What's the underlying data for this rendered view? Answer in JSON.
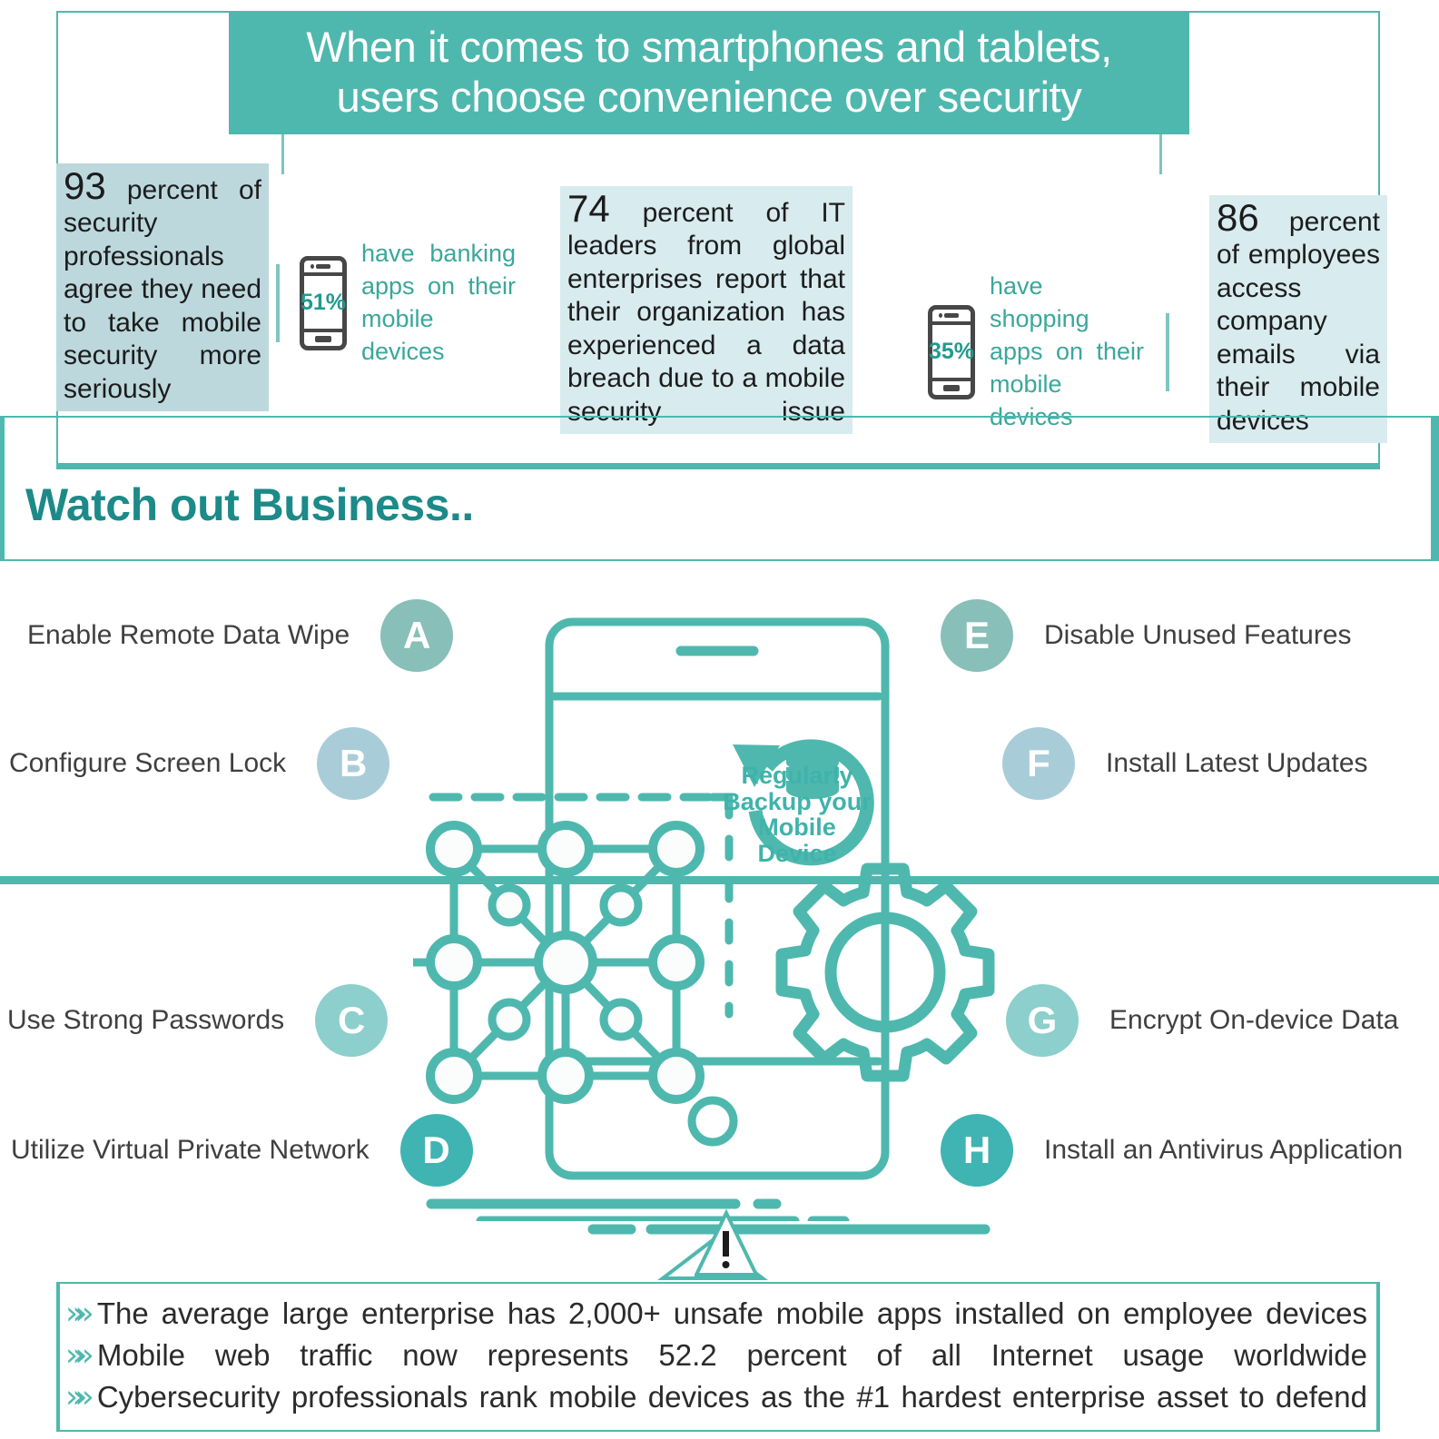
{
  "title": {
    "line1": "When it comes to smartphones and tablets,",
    "line2": "users choose convenience over security"
  },
  "stats": {
    "left_box": {
      "number": "93",
      "text": "percent of security professionals agree they need to take mobile security more seriously"
    },
    "middle_box": {
      "number": "74",
      "text": "percent of IT leaders from global enterprises report that their organization has experienced a data breach due to a mobile security issue"
    },
    "right_box": {
      "number": "86",
      "text": "percent of employees access company emails via their mobile devices"
    },
    "banking": {
      "percent": "51%",
      "text": "have banking apps on their mobile devices"
    },
    "shopping": {
      "percent": "35%",
      "text": "have shopping apps on their mobile devices"
    }
  },
  "section": {
    "heading": "Watch out Business.."
  },
  "tips_left": [
    {
      "letter": "A",
      "label": "Enable Remote Data Wipe",
      "color": "#88bfb8"
    },
    {
      "letter": "B",
      "label": "Configure Screen Lock",
      "color": "#a9cdd8"
    },
    {
      "letter": "C",
      "label": "Use Strong Passwords",
      "color": "#8ccfcd"
    },
    {
      "letter": "D",
      "label": "Utilize Virtual Private Network",
      "color": "#40b3b3"
    }
  ],
  "tips_right": [
    {
      "letter": "E",
      "label": "Disable Unused Features",
      "color": "#88bfb8"
    },
    {
      "letter": "F",
      "label": "Install Latest Updates",
      "color": "#a9cdd8"
    },
    {
      "letter": "G",
      "label": "Encrypt On-device Data",
      "color": "#8ccfcd"
    },
    {
      "letter": "H",
      "label": "Install an Antivirus Application",
      "color": "#40b3b3"
    }
  ],
  "backup": {
    "line1": "Regularly",
    "line2": "Backup your",
    "line3": "Mobile Device"
  },
  "facts": [
    "The average large enterprise has 2,000+ unsafe mobile apps installed on employee devices",
    "Mobile web traffic now represents 52.2 percent of all Internet usage worldwide",
    "Cybersecurity professionals rank mobile devices as the #1 hardest enterprise asset to defend"
  ],
  "colors": {
    "teal": "#4fb8ae",
    "deep_teal": "#1c8a88",
    "pale_blue": "#bcd8dd",
    "paler_blue": "#d8ebee"
  },
  "bullet_glyph": "»»"
}
